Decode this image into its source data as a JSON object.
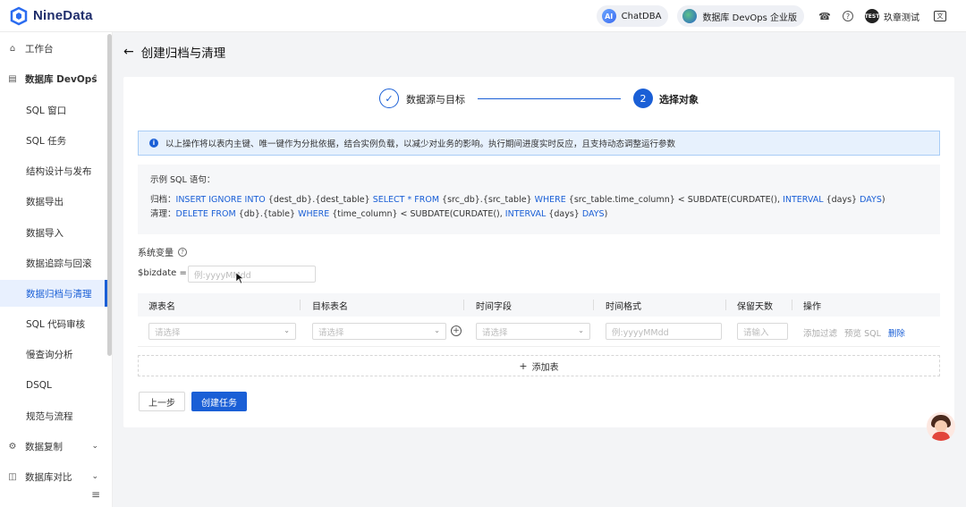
{
  "app": {
    "logo_text": "NineData"
  },
  "topbar": {
    "chatdba_label": "ChatDBA",
    "chatdba_badge": "AI",
    "edition_label": "数据库 DevOps 企业版",
    "user_name": "玖章测试",
    "user_avatar_text": "TEST",
    "icons": [
      "logo-icon",
      "bell-icon",
      "help-icon",
      "language-switch-icon"
    ]
  },
  "sidebar": {
    "items": [
      {
        "label": "工作台",
        "icon": "home-icon",
        "level": 0
      },
      {
        "label": "数据库 DevOps",
        "icon": "devops-icon",
        "level": 0,
        "expanded": true
      },
      {
        "label": "SQL 窗口",
        "level": 1
      },
      {
        "label": "SQL 任务",
        "level": 1
      },
      {
        "label": "结构设计与发布",
        "level": 1
      },
      {
        "label": "数据导出",
        "level": 1
      },
      {
        "label": "数据导入",
        "level": 1
      },
      {
        "label": "数据追踪与回滚",
        "level": 1
      },
      {
        "label": "数据归档与清理",
        "level": 1,
        "active": true
      },
      {
        "label": "SQL 代码审核",
        "level": 1
      },
      {
        "label": "慢查询分析",
        "level": 1
      },
      {
        "label": "DSQL",
        "level": 1
      },
      {
        "label": "规范与流程",
        "level": 1
      },
      {
        "label": "数据复制",
        "icon": "replication-icon",
        "level": 0,
        "expanded": false
      },
      {
        "label": "数据库对比",
        "icon": "compare-icon",
        "level": 0,
        "expanded": false
      }
    ]
  },
  "page": {
    "title": "创建归档与清理",
    "steps": [
      {
        "label": "数据源与目标",
        "state": "done"
      },
      {
        "number": "2",
        "label": "选择对象",
        "state": "current"
      }
    ],
    "notice": "以上操作将以表内主键、唯一键作为分批依据，结合实例负载，以减少对业务的影响。执行期间进度实时反应，且支持动态调整运行参数",
    "sql_example": {
      "title": "示例 SQL 语句：",
      "archive_prefix": "归档：",
      "archive_parts": [
        {
          "text": "INSERT IGNORE INTO",
          "kw": true
        },
        {
          "text": " {dest_db}.{dest_table} ",
          "kw": false
        },
        {
          "text": "SELECT * FROM",
          "kw": true
        },
        {
          "text": " {src_db}.{src_table} ",
          "kw": false
        },
        {
          "text": "WHERE",
          "kw": true
        },
        {
          "text": " {src_table.time_column} < SUBDATE(CURDATE(), ",
          "kw": false
        },
        {
          "text": "INTERVAL",
          "kw": true
        },
        {
          "text": " {days} ",
          "kw": false
        },
        {
          "text": "DAYS",
          "kw": true
        },
        {
          "text": ")",
          "kw": false
        }
      ],
      "cleanup_prefix": "清理：",
      "cleanup_parts": [
        {
          "text": "DELETE FROM",
          "kw": true
        },
        {
          "text": " {db}.{table} ",
          "kw": false
        },
        {
          "text": "WHERE",
          "kw": true
        },
        {
          "text": " {time_column} < SUBDATE(CURDATE(), ",
          "kw": false
        },
        {
          "text": "INTERVAL",
          "kw": true
        },
        {
          "text": " {days} ",
          "kw": false
        },
        {
          "text": "DAYS",
          "kw": true
        },
        {
          "text": ")",
          "kw": false
        }
      ]
    },
    "system_vars_label": "系统变量",
    "bizdate_label": "$bizdate =",
    "bizdate_placeholder": "例:yyyyMMdd",
    "table": {
      "headers": [
        "源表名",
        "目标表名",
        "时间字段",
        "时间格式",
        "保留天数",
        "操作"
      ],
      "row": {
        "source_placeholder": "请选择",
        "target_placeholder": "请选择",
        "time_field_placeholder": "请选择",
        "time_format_placeholder": "例:yyyyMMdd",
        "retain_days_placeholder": "请输入",
        "actions": {
          "add_filter": "添加过滤",
          "preview_sql": "预览 SQL",
          "delete": "删除"
        }
      }
    },
    "add_table_label": "添加表",
    "buttons": {
      "prev": "上一步",
      "create": "创建任务"
    }
  },
  "colors": {
    "primary": "#1a5fd6",
    "notice_bg": "#e7f1fd",
    "sql_bg": "#f6f7f9"
  }
}
